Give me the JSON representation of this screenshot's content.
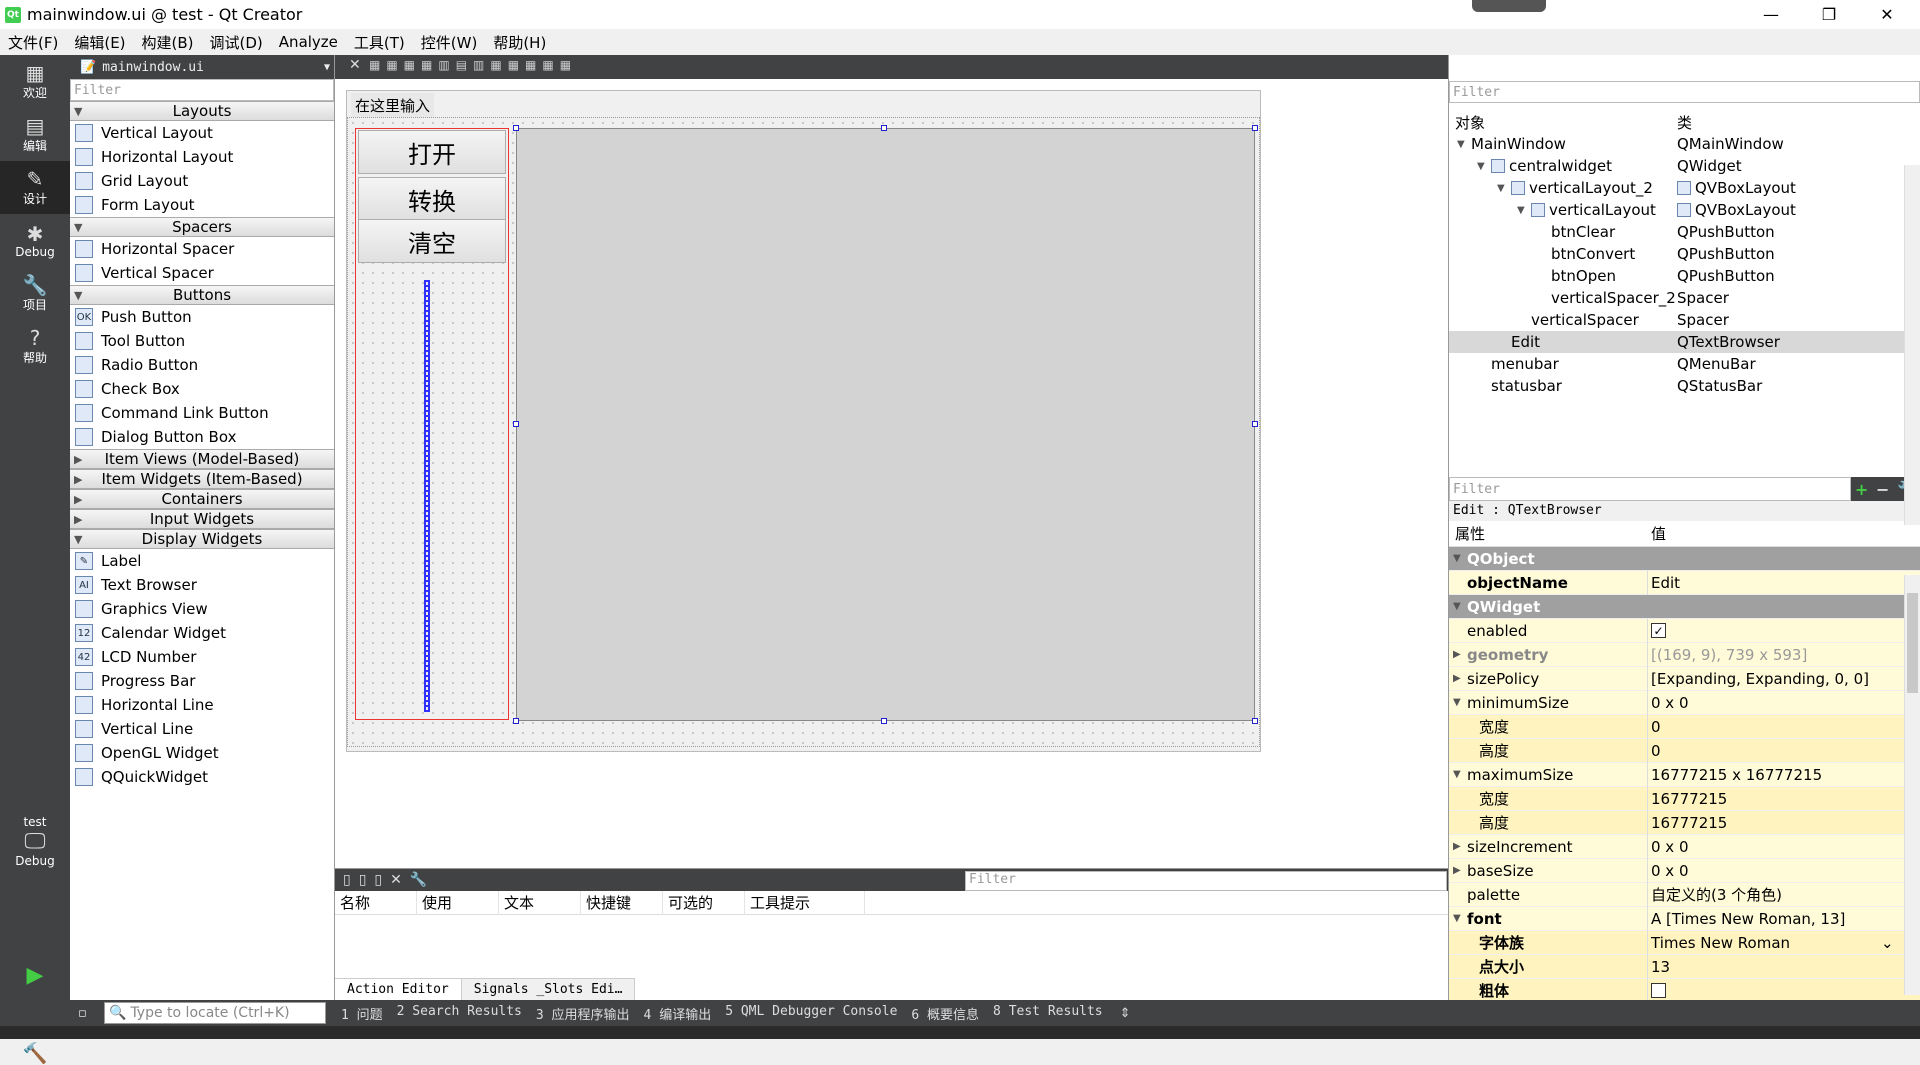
{
  "window": {
    "title": "mainwindow.ui @ test - Qt Creator",
    "min": "—",
    "max": "❐",
    "close": "✕"
  },
  "menu": [
    "文件(F)",
    "编辑(E)",
    "构建(B)",
    "调试(D)",
    "Analyze",
    "工具(T)",
    "控件(W)",
    "帮助(H)"
  ],
  "modes": [
    {
      "label": "欢迎",
      "icon": "welcome-grid-icon"
    },
    {
      "label": "编辑",
      "icon": "edit-doc-icon"
    },
    {
      "label": "设计",
      "icon": "design-pen-icon"
    },
    {
      "label": "Debug",
      "icon": "debug-bug-icon"
    },
    {
      "label": "项目",
      "icon": "project-wrench-icon"
    },
    {
      "label": "帮助",
      "icon": "help-question-icon"
    }
  ],
  "kit": {
    "project": "test",
    "config": "Debug"
  },
  "file_tab": "mainwindow.ui",
  "widgetbox": {
    "filter_placeholder": "Filter",
    "categories": [
      {
        "name": "Layouts",
        "items": [
          "Vertical Layout",
          "Horizontal Layout",
          "Grid Layout",
          "Form Layout"
        ]
      },
      {
        "name": "Spacers",
        "items": [
          "Horizontal Spacer",
          "Vertical Spacer"
        ]
      },
      {
        "name": "Buttons",
        "items": [
          "Push Button",
          "Tool Button",
          "Radio Button",
          "Check Box",
          "Command Link Button",
          "Dialog Button Box"
        ]
      }
    ],
    "collapsed": [
      "Item Views (Model-Based)",
      "Item Widgets (Item-Based)",
      "Containers",
      "Input Widgets"
    ],
    "display_widgets": {
      "name": "Display Widgets",
      "items": [
        "Label",
        "Text Browser",
        "Graphics View",
        "Calendar Widget",
        "LCD Number",
        "Progress Bar",
        "Horizontal Line",
        "Vertical Line",
        "OpenGL Widget",
        "QQuickWidget"
      ]
    }
  },
  "form": {
    "menu_placeholder": "在这里输入",
    "buttons": [
      "打开",
      "转换",
      "清空"
    ]
  },
  "action_editor": {
    "filter_placeholder": "Filter",
    "columns": [
      "名称",
      "使用",
      "文本",
      "快捷键",
      "可选的",
      "工具提示"
    ],
    "tabs": [
      "Action Editor",
      "Signals _Slots Edi…"
    ]
  },
  "object_inspector": {
    "filter_placeholder": "Filter",
    "headers": [
      "对象",
      "类"
    ],
    "rows": [
      {
        "name": "MainWindow",
        "cls": "QMainWindow",
        "level": 0
      },
      {
        "name": "centralwidget",
        "cls": "QWidget",
        "level": 1
      },
      {
        "name": "verticalLayout_2",
        "cls": "QVBoxLayout",
        "level": 2
      },
      {
        "name": "verticalLayout",
        "cls": "QVBoxLayout",
        "level": 3
      },
      {
        "name": "btnClear",
        "cls": "QPushButton",
        "level": 4
      },
      {
        "name": "btnConvert",
        "cls": "QPushButton",
        "level": 4
      },
      {
        "name": "btnOpen",
        "cls": "QPushButton",
        "level": 4
      },
      {
        "name": "verticalSpacer_2",
        "cls": "Spacer",
        "level": 4
      },
      {
        "name": "verticalSpacer",
        "cls": "Spacer",
        "level": 3
      },
      {
        "name": "Edit",
        "cls": "QTextBrowser",
        "level": 2
      },
      {
        "name": "menubar",
        "cls": "QMenuBar",
        "level": 1
      },
      {
        "name": "statusbar",
        "cls": "QStatusBar",
        "level": 1
      }
    ]
  },
  "property_editor": {
    "filter_placeholder": "Filter",
    "context": "Edit : QTextBrowser",
    "headers": [
      "属性",
      "值"
    ],
    "rows": [
      {
        "name": "QObject",
        "value": "",
        "kind": "group"
      },
      {
        "name": "objectName",
        "value": "Edit",
        "kind": "bold"
      },
      {
        "name": "QWidget",
        "value": "",
        "kind": "group"
      },
      {
        "name": "enabled",
        "value": "✓",
        "kind": "check"
      },
      {
        "name": "geometry",
        "value": "[(169, 9), 739 x 593]",
        "kind": "disabled"
      },
      {
        "name": "sizePolicy",
        "value": "[Expanding, Expanding, 0, 0]",
        "kind": "collapsed"
      },
      {
        "name": "minimumSize",
        "value": "0 x 0",
        "kind": "expanded"
      },
      {
        "name": "宽度",
        "value": "0",
        "kind": "sub"
      },
      {
        "name": "高度",
        "value": "0",
        "kind": "sub"
      },
      {
        "name": "maximumSize",
        "value": "16777215 x 16777215",
        "kind": "expanded"
      },
      {
        "name": "宽度",
        "value": "16777215",
        "kind": "sub"
      },
      {
        "name": "高度",
        "value": "16777215",
        "kind": "sub"
      },
      {
        "name": "sizeIncrement",
        "value": "0 x 0",
        "kind": "collapsed"
      },
      {
        "name": "baseSize",
        "value": "0 x 0",
        "kind": "collapsed"
      },
      {
        "name": "palette",
        "value": "自定义的(3 个角色)",
        "kind": "plain"
      },
      {
        "name": "font",
        "value": "A [Times New Roman, 13]",
        "kind": "expanded-bold"
      },
      {
        "name": "字体族",
        "value": "Times New Roman",
        "kind": "sub-bold-select"
      },
      {
        "name": "点大小",
        "value": "13",
        "kind": "sub-bold"
      },
      {
        "name": "粗体",
        "value": "",
        "kind": "sub-bold-check"
      }
    ]
  },
  "statusbar": {
    "locate_placeholder": "Type to locate (Ctrl+K)",
    "outputs": [
      "1 问题",
      "2 Search Results",
      "3 应用程序输出",
      "4 编译输出",
      "5 QML Debugger Console",
      "6 概要信息",
      "8 Test Results"
    ]
  },
  "colors": {
    "selection": "#d8d8d8",
    "property_bg": "#fffbd8",
    "group_bg": "#a0a0a0",
    "sidebar": "#404244"
  }
}
